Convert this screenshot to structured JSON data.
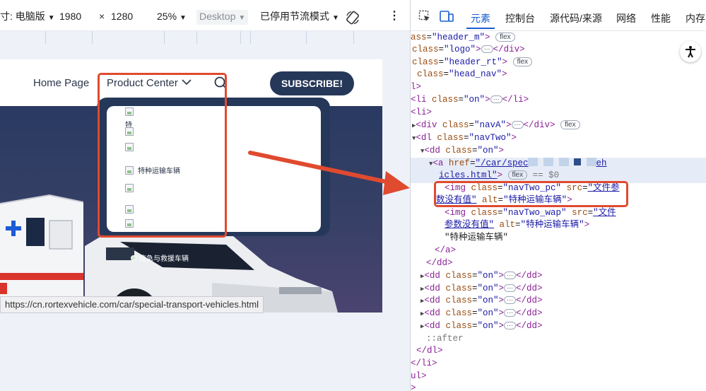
{
  "toolbar": {
    "device_label": "寸: 电脑版",
    "width_value": "1980",
    "times_symbol": "×",
    "height_value": "1280",
    "zoom": "25%",
    "mode": "Desktop",
    "throttle": "已停用节流模式",
    "more": "⋮"
  },
  "site": {
    "nav_home": "Home Page",
    "nav_product": "Product Center",
    "subscribe": "SUBSCRIBE!",
    "dropdown": {
      "item_b_text": "特",
      "item_c_text": "特种运输车辆",
      "item_e_text": "应急与救援车辆"
    },
    "hover_url": "https://cn.rortexvehicle.com/car/special-transport-vehicles.html"
  },
  "devtools": {
    "tabs": [
      "元素",
      "控制台",
      "源代码/来源",
      "网络",
      "性能",
      "内存"
    ],
    "lines": {
      "l1_class": "\"header_m\"",
      "l2_class": "\"logo\"",
      "l3_class": "\"header_rt\"",
      "l4_class": "\"head_nav\"",
      "l6_class": "\"on\"",
      "l8_class": "\"navA\"",
      "l9_class": "\"navTwo\"",
      "l10_class": "\"on\"",
      "l11_href": "\"/car/spec",
      "l11_href_end": "eh",
      "l12_href": "icles.html\"",
      "l12_eq": "== $0",
      "l13_class": "\"navTwo_pc\"",
      "l13_src": "\"文件参",
      "l14_src": "数没有值\"",
      "l14_alt": "\"特种运输车辆\"",
      "l15_class": "\"navTwo_wap\"",
      "l15_src": "\"文件",
      "l16_src": "参数没有值\"",
      "l16_alt": "\"特种运输车辆\"",
      "l17_text": "\"特种运输车辆\"",
      "dd_class": "\"on\"",
      "after": "::after"
    },
    "badge_flex": "flex",
    "dots": "···"
  },
  "colors": {
    "accent_blue": "#1a5fd0",
    "annotation_red": "#e04a2f",
    "nav_dark": "#263859"
  }
}
